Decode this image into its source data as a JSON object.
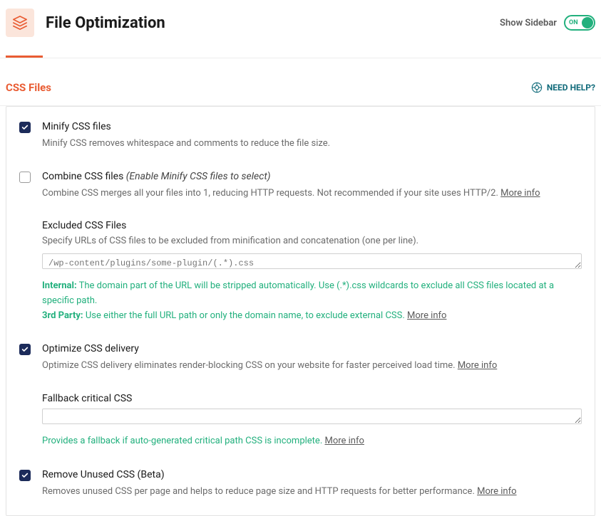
{
  "header": {
    "title": "File Optimization",
    "sidebar_label": "Show Sidebar",
    "toggle_state": "ON"
  },
  "section": {
    "title": "CSS Files",
    "help": "NEED HELP?"
  },
  "options": {
    "minify": {
      "title": "Minify CSS files",
      "desc": "Minify CSS removes whitespace and comments to reduce the file size."
    },
    "combine": {
      "title": "Combine CSS files",
      "italic": "(Enable Minify CSS files to select)",
      "desc": "Combine CSS merges all your files into 1, reducing HTTP requests. Not recommended if your site uses HTTP/2.",
      "more": "More info",
      "excluded_label": "Excluded CSS Files",
      "excluded_desc": "Specify URLs of CSS files to be excluded from minification and concatenation (one per line).",
      "excluded_placeholder": "/wp-content/plugins/some-plugin/(.*).css",
      "hint_internal_label": "Internal:",
      "hint_internal_text": "The domain part of the URL will be stripped automatically. Use (.*).css wildcards to exclude all CSS files located at a specific path.",
      "hint_third_label": "3rd Party:",
      "hint_third_text": "Use either the full URL path or only the domain name, to exclude external CSS.",
      "hint_more": "More info"
    },
    "optimize": {
      "title": "Optimize CSS delivery",
      "desc": "Optimize CSS delivery eliminates render-blocking CSS on your website for faster perceived load time.",
      "more": "More info",
      "fallback_label": "Fallback critical CSS",
      "fallback_hint": "Provides a fallback if auto-generated critical path CSS is incomplete.",
      "fallback_more": "More info"
    },
    "remove_unused": {
      "title": "Remove Unused CSS (Beta)",
      "desc": "Removes unused CSS per page and helps to reduce page size and HTTP requests for better performance.",
      "more": "More info"
    }
  }
}
